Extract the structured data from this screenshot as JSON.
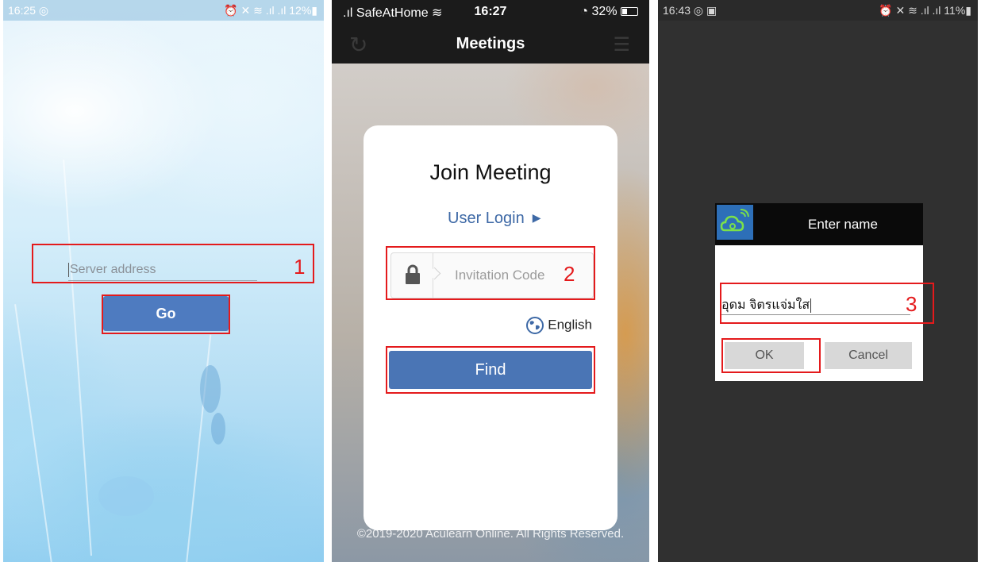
{
  "panel1": {
    "status": {
      "time": "16:25 ◎",
      "icons": "⏰ ✕ ≋ .ıl .ıl 12%▮"
    },
    "server_placeholder": "Server address",
    "go_label": "Go",
    "annotation_number": "1"
  },
  "panel2": {
    "status": {
      "carrier": ".ıl SafeAtHome ≋",
      "time": "16:27",
      "battery": "◔ 32%"
    },
    "title": "Meetings",
    "icons": {
      "left": "refresh-icon",
      "right": "list-icon"
    },
    "join_title": "Join Meeting",
    "user_login": "User Login",
    "invitation_placeholder": "Invitation Code",
    "language": "English",
    "find_label": "Find",
    "copyright": "©2019-2020 Aculearn Online. All Rights Reserved.",
    "annotation_number": "2"
  },
  "panel3": {
    "status": {
      "time": "16:43 ◎ ▣",
      "icons": "⏰ ✕ ≋ .ıl .ıl 11%▮"
    },
    "dialog_title": "Enter name",
    "name_value": "อุดม จิตรแจ่มใส",
    "ok_label": "OK",
    "cancel_label": "Cancel",
    "annotation_number": "3"
  },
  "colors": {
    "annotation": "#e41a1c",
    "primary_button": "#4a75b5",
    "link": "#3e69a6"
  }
}
